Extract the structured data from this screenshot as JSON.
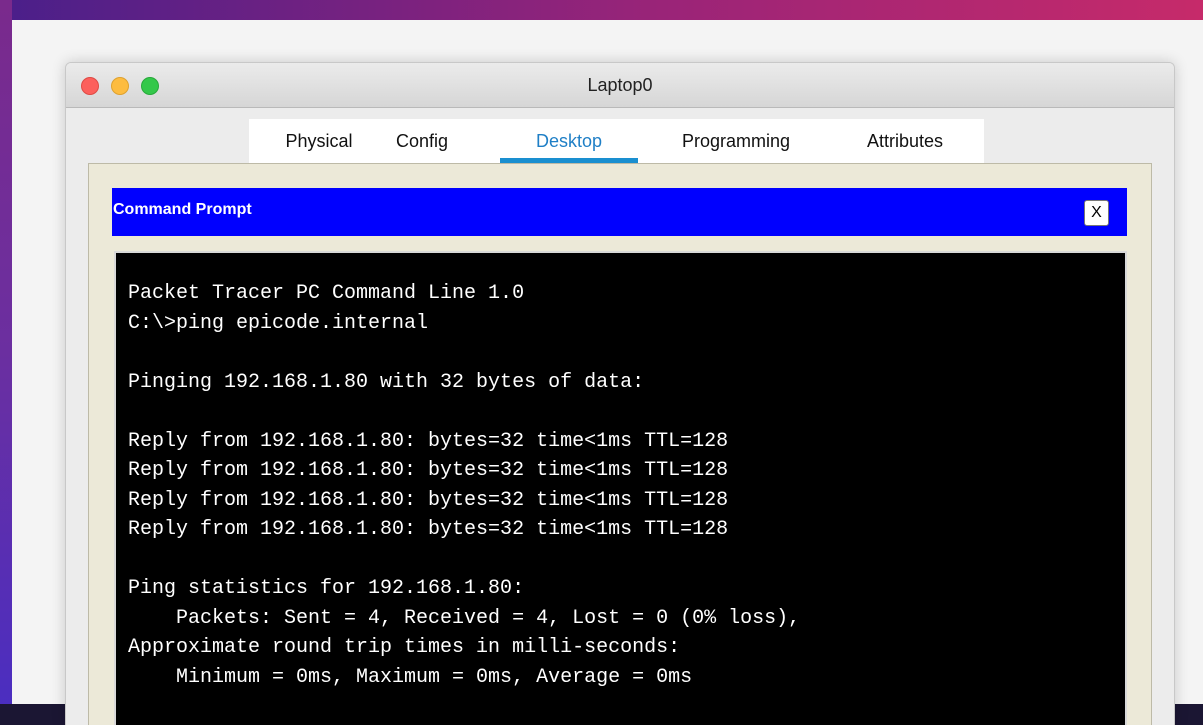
{
  "window": {
    "title": "Laptop0"
  },
  "tabs": [
    {
      "label": "Physical",
      "active": false
    },
    {
      "label": "Config",
      "active": false
    },
    {
      "label": "Desktop",
      "active": true
    },
    {
      "label": "Programming",
      "active": false
    },
    {
      "label": "Attributes",
      "active": false
    }
  ],
  "command_prompt": {
    "title": "Command Prompt",
    "close_label": "X",
    "output": "Packet Tracer PC Command Line 1.0\nC:\\>ping epicode.internal\n\nPinging 192.168.1.80 with 32 bytes of data:\n\nReply from 192.168.1.80: bytes=32 time<1ms TTL=128\nReply from 192.168.1.80: bytes=32 time<1ms TTL=128\nReply from 192.168.1.80: bytes=32 time<1ms TTL=128\nReply from 192.168.1.80: bytes=32 time<1ms TTL=128\n\nPing statistics for 192.168.1.80:\n    Packets: Sent = 4, Received = 4, Lost = 0 (0% loss),\nApproximate round trip times in milli-seconds:\n    Minimum = 0ms, Maximum = 0ms, Average = 0ms"
  },
  "colors": {
    "command_header": "#0000ff",
    "active_tab": "#1a8fd0",
    "terminal_bg": "#000000",
    "terminal_text": "#ffffff"
  }
}
